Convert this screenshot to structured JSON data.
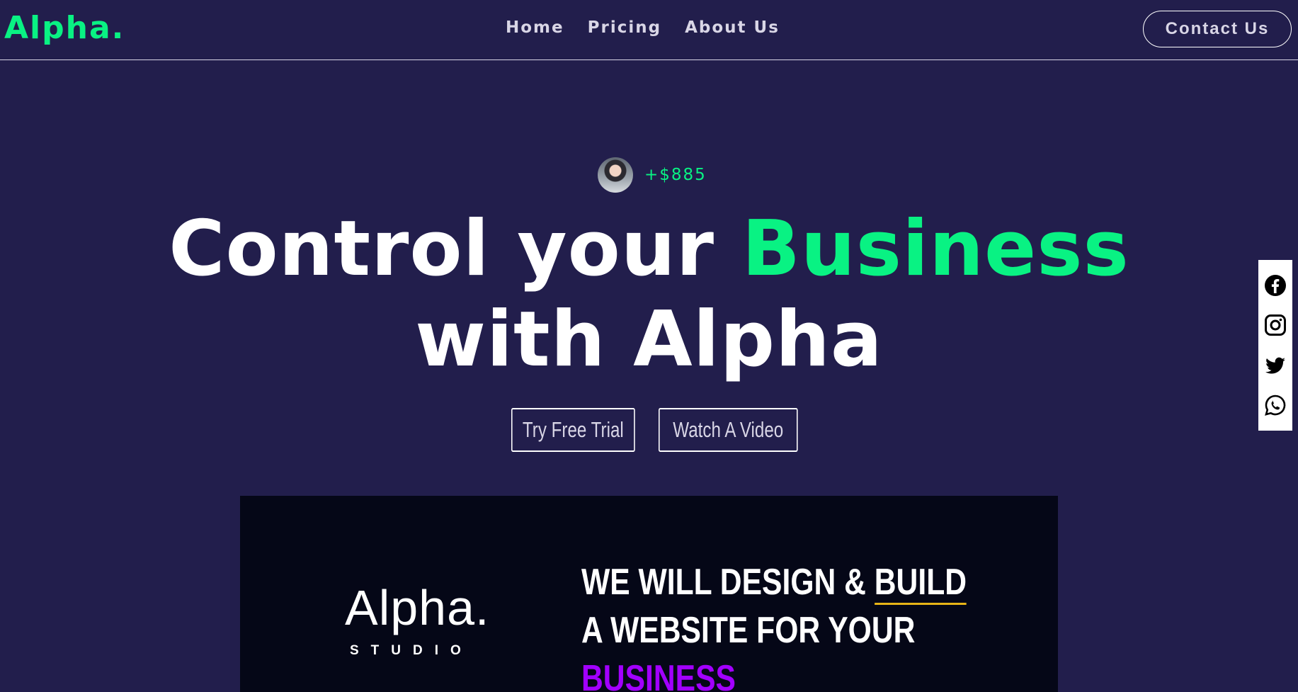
{
  "header": {
    "logo": "Alpha.",
    "nav": [
      {
        "label": "Home"
      },
      {
        "label": "Pricing"
      },
      {
        "label": "About Us"
      }
    ],
    "contact_label": "Contact Us"
  },
  "hero": {
    "badge_amount": "+$885",
    "title_part1": "Control your ",
    "title_accent": "Business",
    "title_line2": "with Alpha",
    "cta_trial": "Try Free Trial",
    "cta_video": "Watch A Video"
  },
  "media": {
    "brand": "Alpha.",
    "brand_sub": "STUDIO",
    "line1_a": "WE WILL DESIGN & ",
    "line1_b": "BUILD",
    "line2": "A WEBSITE FOR YOUR",
    "line3": "BUSINESS"
  },
  "social": {
    "icons": [
      "facebook-icon",
      "instagram-icon",
      "twitter-icon",
      "whatsapp-icon"
    ]
  },
  "colors": {
    "background": "#221e4c",
    "accent": "#09f283",
    "highlight_purple": "#a200ff",
    "underline_yellow": "#e7b417"
  }
}
